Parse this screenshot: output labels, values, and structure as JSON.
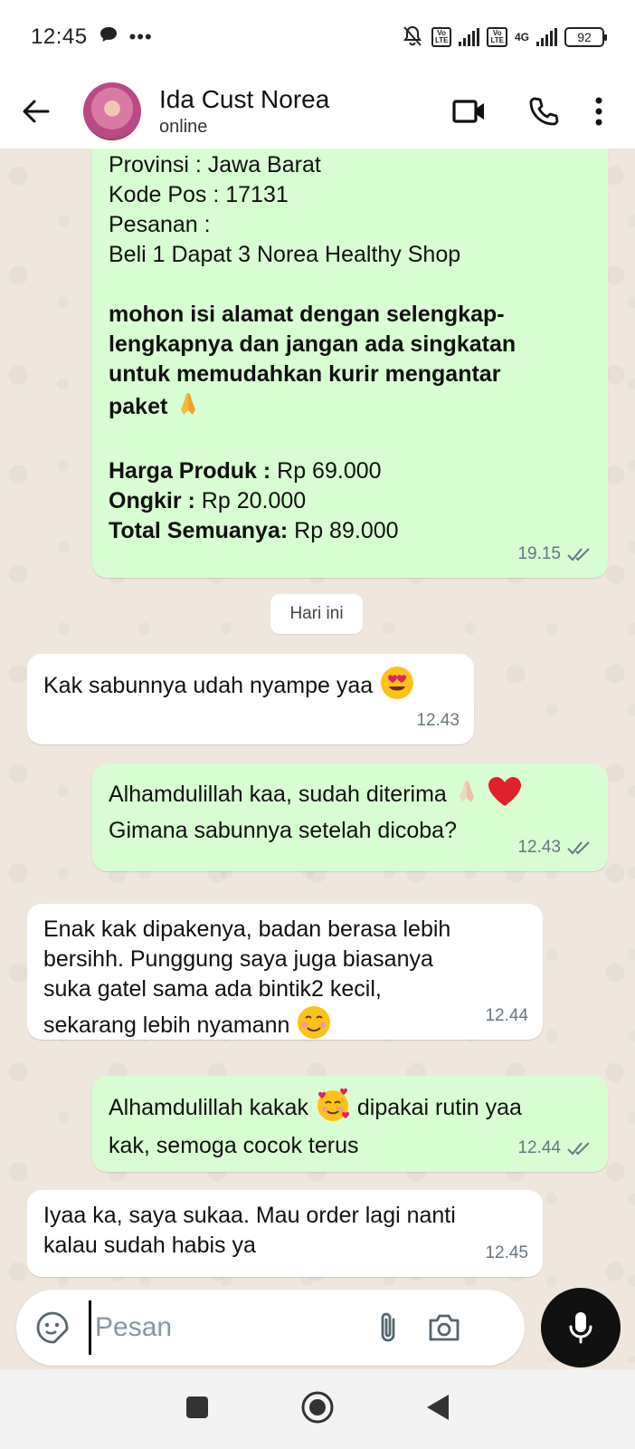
{
  "status_bar": {
    "time": "12:45",
    "network_type": "4G",
    "volte_label": "Vo LTE",
    "battery": "92"
  },
  "header": {
    "contact_name": "Ida Cust Norea",
    "contact_status": "online"
  },
  "messages": [
    {
      "direction": "outgoing",
      "lines": [
        "Provinsi : Jawa Barat",
        "Kode Pos : 17131",
        "Pesanan :",
        "Beli 1 Dapat 3 Norea Healthy Shop"
      ],
      "bold_note": "mohon isi alamat dengan selengkap-lengkapnya dan jangan ada singkatan untuk memudahkan kurir mengantar paket",
      "price_label": "Harga Produk :",
      "price_value": "Rp 69.000",
      "shipping_label": "Ongkir :",
      "shipping_value": "Rp 20.000",
      "total_label": "Total Semuanya:",
      "total_value": "Rp 89.000",
      "time": "19.15"
    },
    {
      "direction": "incoming",
      "text": "Kak sabunnya udah nyampe yaa",
      "time": "12.43"
    },
    {
      "direction": "outgoing",
      "line1": "Alhamdulillah kaa, sudah diterima",
      "line2": "Gimana sabunnya setelah dicoba?",
      "time": "12.43"
    },
    {
      "direction": "incoming",
      "line1": "Enak kak dipakenya, badan berasa lebih",
      "line2": "bersihh. Punggung saya juga biasanya",
      "line3": "suka gatel sama ada bintik2 kecil,",
      "line4": "sekarang lebih nyamann",
      "time": "12.44"
    },
    {
      "direction": "outgoing",
      "line1_a": "Alhamdulillah kakak",
      "line1_b": "dipakai rutin yaa",
      "line2": "kak, semoga cocok terus",
      "time": "12.44"
    },
    {
      "direction": "incoming",
      "line1": "Iyaa ka, saya sukaa. Mau order lagi nanti",
      "line2": "kalau sudah habis ya",
      "time": "12.45"
    }
  ],
  "day_divider": "Hari ini",
  "composer": {
    "placeholder": "Pesan"
  },
  "colors": {
    "outgoing_bubble": "#d9fdd3",
    "incoming_bubble": "#ffffff",
    "chat_background": "#efe7dd",
    "read_ticks": "#667781"
  }
}
